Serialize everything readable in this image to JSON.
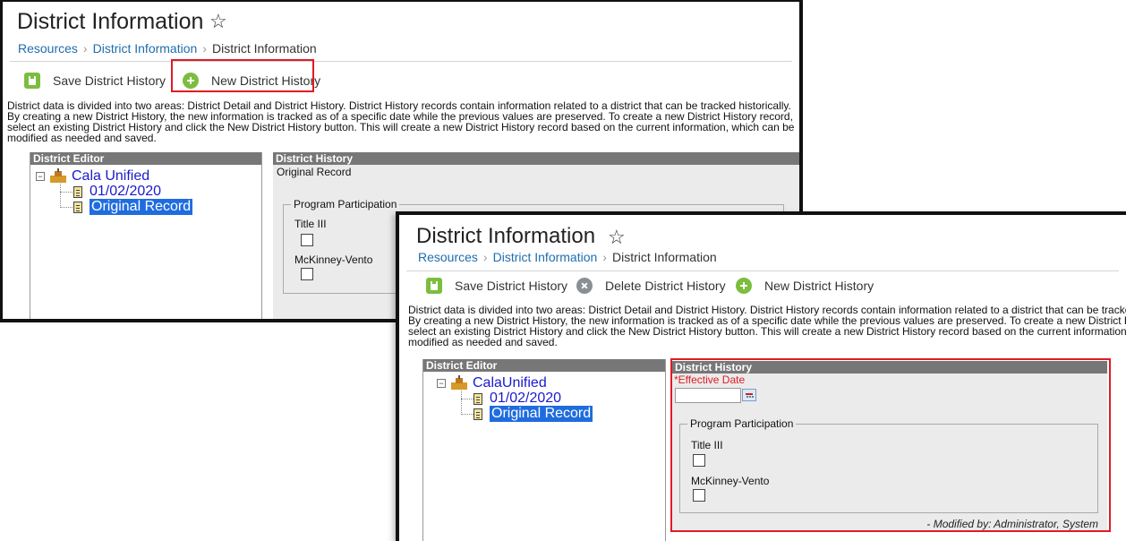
{
  "back": {
    "title": "District Information",
    "breadcrumb": [
      "Resources",
      "District Information",
      "District Information"
    ],
    "toolbar": {
      "save": "Save District History",
      "new": "New District History"
    },
    "description": [
      "District data is divided into two areas: District Detail and District History. District History records contain information related to a district that can be tracked historically.",
      "By creating a new District History, the new information is tracked as of a specific date while the previous values are preserved. To create a new District History record,",
      "select an existing District History and click the New District History button. This will create a new District History record based on the current information, which can be",
      "modified as needed and saved."
    ],
    "editor": {
      "header": "District Editor",
      "district": "Cala Unified",
      "records": [
        "01/02/2020",
        "Original Record"
      ]
    },
    "history": {
      "header": "District History",
      "subtitle": "Original Record",
      "program_participation": "Program Participation",
      "fields": [
        "Title III",
        "McKinney-Vento"
      ]
    }
  },
  "front": {
    "title": "District Information",
    "breadcrumb": [
      "Resources",
      "District Information",
      "District Information"
    ],
    "toolbar": {
      "save": "Save District History",
      "delete": "Delete District History",
      "new": "New District History"
    },
    "description": [
      "District data is divided into two areas: District Detail and District History. District History records contain information related to a district that can be tracked",
      "By creating a new District History, the new information is tracked as of a specific date while the previous values are preserved. To create a new District Histo",
      "select an existing District History and click the New District History button. This will create a new District History record based on the current information, w",
      "modified as needed and saved."
    ],
    "editor": {
      "header": "District Editor",
      "district": "CalaUnified",
      "records": [
        "01/02/2020",
        "Original Record"
      ]
    },
    "history": {
      "header": "District History",
      "effective_date_label": "*Effective Date",
      "effective_date_value": "",
      "program_participation": "Program Participation",
      "fields": [
        "Title III",
        "McKinney-Vento"
      ],
      "modified_by": "- Modified by: Administrator, System"
    }
  },
  "colors": {
    "accent_green": "#7cbd3f",
    "highlight_red": "#e01b24",
    "link_blue": "#1f6cae",
    "panel_header": "#777777"
  }
}
